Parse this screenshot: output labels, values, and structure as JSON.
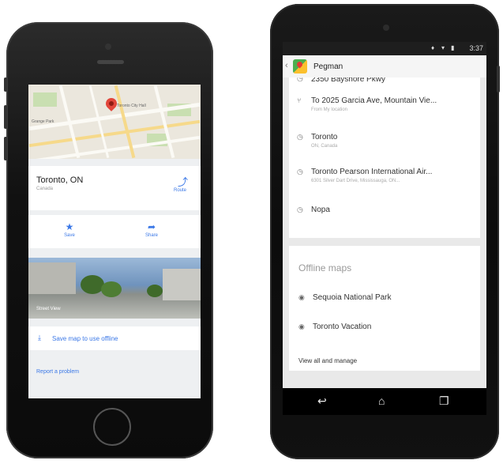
{
  "iphone": {
    "place": {
      "name": "Toronto, ON",
      "region": "Canada"
    },
    "route_label": "Route",
    "actions": {
      "save_label": "Save",
      "share_label": "Share"
    },
    "street_view_label": "Street View",
    "offline_label": "Save map to use offline",
    "report_label": "Report a problem",
    "icons": {
      "route": "route-icon",
      "save": "star-icon",
      "share": "share-icon",
      "download": "download-icon"
    }
  },
  "android": {
    "status": {
      "time": "3:37"
    },
    "toolbar": {
      "title": "Pegman"
    },
    "history": [
      {
        "title": "2350 Bayshore Pkwy",
        "subtitle": "",
        "icon": "clock-icon"
      },
      {
        "title": "To 2025 Garcia Ave, Mountain Vie...",
        "subtitle": "From My location",
        "icon": "directions-icon"
      },
      {
        "title": "Toronto",
        "subtitle": "ON, Canada",
        "icon": "clock-icon"
      },
      {
        "title": "Toronto Pearson International Air...",
        "subtitle": "6301 Silver Dart Drive, Mississauga, ON...",
        "icon": "clock-icon"
      },
      {
        "title": "Nopa",
        "subtitle": "",
        "icon": "clock-icon"
      }
    ],
    "offline": {
      "title": "Offline maps",
      "items": [
        "Sequoia National Park",
        "Toronto Vacation"
      ],
      "view_all_label": "View all and manage"
    }
  },
  "colors": {
    "accent": "#3b78e7",
    "pin": "#e2463b"
  }
}
